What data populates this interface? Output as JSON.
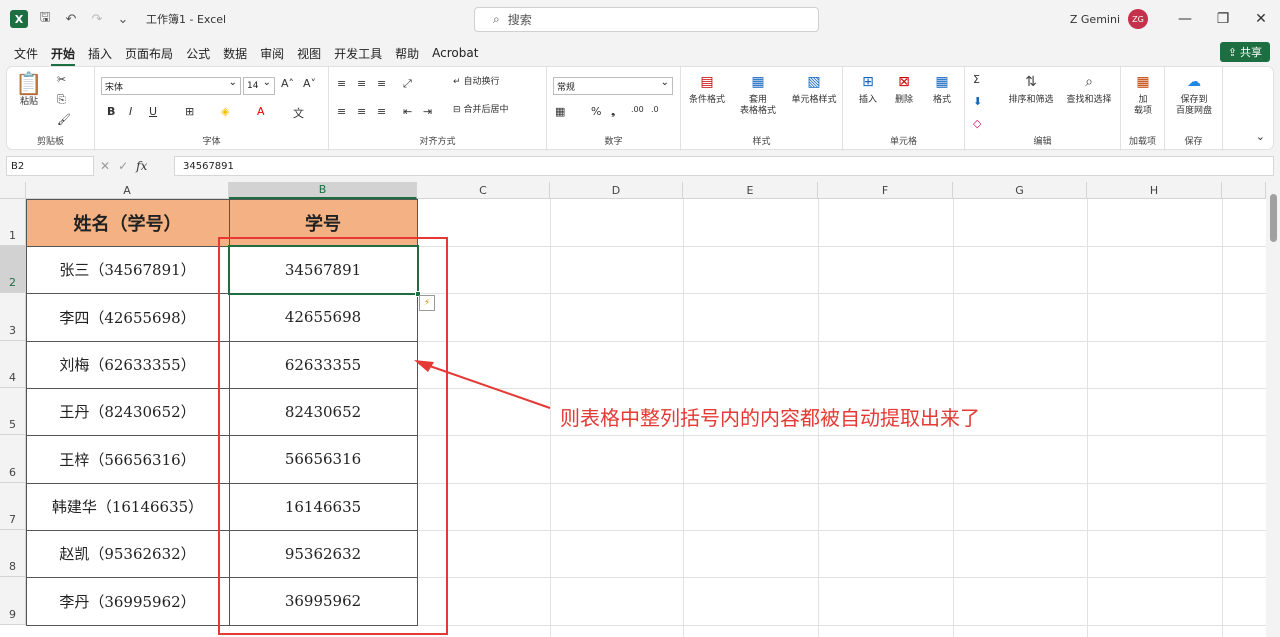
{
  "titlebar": {
    "title": "工作簿1 - Excel",
    "search_placeholder": "搜索",
    "user_name": "Z Gemini",
    "user_initials": "ZG"
  },
  "menu": {
    "tabs": [
      "文件",
      "开始",
      "插入",
      "页面布局",
      "公式",
      "数据",
      "审阅",
      "视图",
      "开发工具",
      "帮助",
      "Acrobat"
    ],
    "active": "开始",
    "share_label": "共享"
  },
  "ribbon": {
    "clipboard": {
      "paste": "粘贴",
      "label": "剪贴板"
    },
    "font": {
      "family": "宋体",
      "size": "14",
      "label": "字体"
    },
    "alignment": {
      "wrap": "自动换行",
      "merge": "合并后居中",
      "label": "对齐方式"
    },
    "number": {
      "format": "常规",
      "label": "数字"
    },
    "styles": {
      "cond": "条件格式",
      "table": "套用\n表格格式",
      "cell": "单元格样式",
      "label": "样式"
    },
    "cells": {
      "insert": "插入",
      "delete": "删除",
      "format": "格式",
      "label": "单元格"
    },
    "editing": {
      "sort": "排序和筛选",
      "find": "查找和选择",
      "label": "编辑"
    },
    "addins": {
      "btn": "加\n载项",
      "label": "加载项"
    },
    "save": {
      "btn": "保存到\n百度网盘",
      "label": "保存"
    }
  },
  "formula_bar": {
    "name_box": "B2",
    "fx": "fx",
    "value": "34567891"
  },
  "sheet": {
    "columns": [
      "A",
      "B",
      "C",
      "D",
      "E",
      "F",
      "G",
      "H"
    ],
    "rows": [
      "1",
      "2",
      "3",
      "4",
      "5",
      "6",
      "7",
      "8",
      "9"
    ],
    "header": [
      "姓名（学号）",
      "学号"
    ],
    "data": [
      [
        "张三（34567891）",
        "34567891"
      ],
      [
        "李四（42655698）",
        "42655698"
      ],
      [
        "刘梅（62633355）",
        "62633355"
      ],
      [
        "王丹（82430652）",
        "82430652"
      ],
      [
        "王梓（56656316）",
        "56656316"
      ],
      [
        "韩建华（16146635）",
        "16146635"
      ],
      [
        "赵凯（95362632）",
        "95362632"
      ],
      [
        "李丹（36995962）",
        "36995962"
      ]
    ]
  },
  "annotation": "则表格中整列括号内的内容都被自动提取出来了",
  "colors": {
    "accent": "#1d6f42",
    "header_fill": "#f4b183",
    "annotation": "#e53935"
  }
}
